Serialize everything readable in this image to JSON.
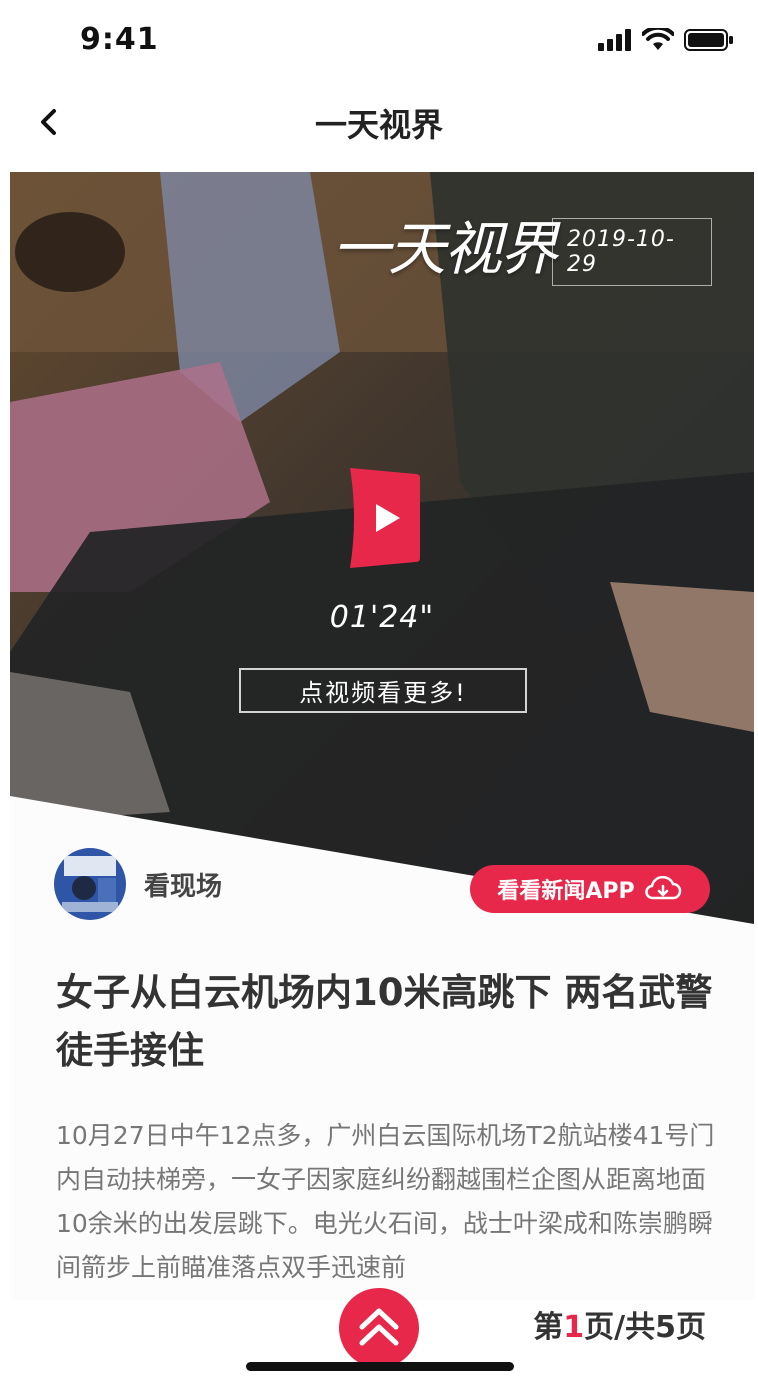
{
  "status_bar": {
    "time": "9:41",
    "icons": [
      "signal-icon",
      "wifi-icon",
      "battery-icon"
    ]
  },
  "nav": {
    "back_icon": "chevron-left-icon",
    "title": "一天视界"
  },
  "video": {
    "brand": "一天视界",
    "date": "2019-10-29",
    "play_icon": "play-icon",
    "duration": "01'24\"",
    "more_label": "点视频看更多!"
  },
  "author": {
    "name": "看现场"
  },
  "app_button": {
    "label": "看看新闻APP",
    "icon": "cloud-download-icon"
  },
  "article": {
    "headline": "女子从白云机场内10米高跳下 两名武警徒手接住",
    "body": "10月27日中午12点多，广州白云国际机场T2航站楼41号门内自动扶梯旁，一女子因家庭纠纷翻越围栏企图从距离地面10余米的出发层跳下。电光火石间，战士叶梁成和陈崇鹏瞬间箭步上前瞄准落点双手迅速前"
  },
  "pager": {
    "prefix": "第",
    "current": "1",
    "suffix": "页/共5页"
  },
  "colors": {
    "accent": "#e8284a"
  }
}
